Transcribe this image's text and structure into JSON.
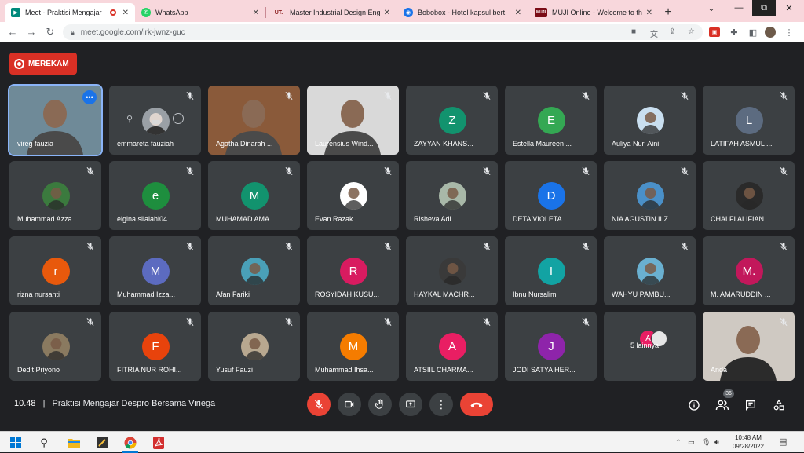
{
  "browser": {
    "tabs": [
      {
        "title": "Meet - Praktisi Mengajar",
        "fav_color": "#00897b",
        "fav_text": "M",
        "active": true
      },
      {
        "title": "WhatsApp",
        "fav_color": "#25d366",
        "fav_text": "W"
      },
      {
        "title": "Master Industrial Design Eng",
        "fav_color": "#8a1c1c",
        "fav_text": "UT."
      },
      {
        "title": "Bobobox - Hotel kapsul bert",
        "fav_color": "#1a73e8",
        "fav_text": "B"
      },
      {
        "title": "MUJI Online - Welcome to th",
        "fav_color": "#7a0c16",
        "fav_text": "MUJI"
      }
    ],
    "url": "meet.google.com/irk-jwnz-guc"
  },
  "meet": {
    "recording_label": "MEREKAM",
    "participants": [
      {
        "name": "vireg fauzia",
        "type": "video",
        "bg": "#6f8a98"
      },
      {
        "name": "emmareta fauziah",
        "type": "pinned-photo"
      },
      {
        "name": "Agatha Dinarah ...",
        "type": "video",
        "bg": "#8a5a3a"
      },
      {
        "name": "Laurensius Wind...",
        "type": "video",
        "bg": "#d9d9d9"
      },
      {
        "name": "ZAYYAN KHANS...",
        "initial": "Z",
        "color": "#12936e"
      },
      {
        "name": "Estella Maureen ...",
        "initial": "E",
        "color": "#34a853"
      },
      {
        "name": "Auliya Nur' Aini",
        "type": "photo",
        "color": "#c9dff0"
      },
      {
        "name": "LATIFAH ASMUL ...",
        "initial": "L",
        "color": "#5c6b80"
      },
      {
        "name": "Muhammad Azza...",
        "type": "photo",
        "color": "#3b7a3e"
      },
      {
        "name": "elgina silalahi04",
        "initial": "e",
        "color": "#1e8e3e"
      },
      {
        "name": "MUHAMAD AMA...",
        "initial": "M",
        "color": "#12936e"
      },
      {
        "name": "Evan Razak",
        "type": "photo",
        "color": "#ffffff"
      },
      {
        "name": "Risheva Adi",
        "type": "photo",
        "color": "#a8b8a8"
      },
      {
        "name": "DETA VIOLETA",
        "initial": "D",
        "color": "#1a73e8"
      },
      {
        "name": "NIA AGUSTIN ILZ...",
        "type": "photo",
        "color": "#4a90c8"
      },
      {
        "name": "CHALFI ALIFIAN ...",
        "type": "photo",
        "color": "#2a2a2a"
      },
      {
        "name": "rizna nursanti",
        "initial": "r",
        "color": "#e8590c"
      },
      {
        "name": "Muhammad Izza...",
        "initial": "M",
        "color": "#5c6bc0"
      },
      {
        "name": "Afan Fariki",
        "type": "photo",
        "color": "#4aa0b8"
      },
      {
        "name": "ROSYIDAH KUSU...",
        "initial": "R",
        "color": "#d81b60"
      },
      {
        "name": "HAYKAL MACHR...",
        "type": "photo",
        "color": "#3a3a3a"
      },
      {
        "name": "Ibnu Nursalim",
        "initial": "I",
        "color": "#12a3a3"
      },
      {
        "name": "WAHYU PAMBU...",
        "type": "photo",
        "color": "#6ab0d0"
      },
      {
        "name": "M. AMARUDDIN ...",
        "initial": "M.",
        "color": "#c2185b"
      },
      {
        "name": "Dedit Priyono",
        "type": "photo",
        "color": "#8a7a60"
      },
      {
        "name": "FITRIA NUR ROHI...",
        "initial": "F",
        "color": "#e8430c"
      },
      {
        "name": "Yusuf Fauzi",
        "type": "photo",
        "color": "#b8a890"
      },
      {
        "name": "Muhammad Ihsa...",
        "initial": "M",
        "color": "#f57c00"
      },
      {
        "name": "ATSIIL CHARMA...",
        "initial": "A",
        "color": "#e91e63"
      },
      {
        "name": "JODI SATYA HER...",
        "initial": "J",
        "color": "#8e24aa"
      },
      {
        "name": "5 lainnya",
        "type": "others",
        "initial": "A",
        "color": "#e91e63"
      },
      {
        "name": "Anda",
        "type": "self-video",
        "bg": "#cfc9c2"
      }
    ],
    "footer": {
      "time": "10.48",
      "separator": "|",
      "meeting_title": "Praktisi Mengajar Despro Bersama Viriega",
      "people_count": "36"
    }
  },
  "taskbar": {
    "clock_time": "10:48 AM",
    "clock_date": "09/28/2022"
  },
  "colors": {
    "accent": "#8ab4f8",
    "danger": "#ea4335",
    "tile": "#3c4043",
    "background": "#202124"
  }
}
